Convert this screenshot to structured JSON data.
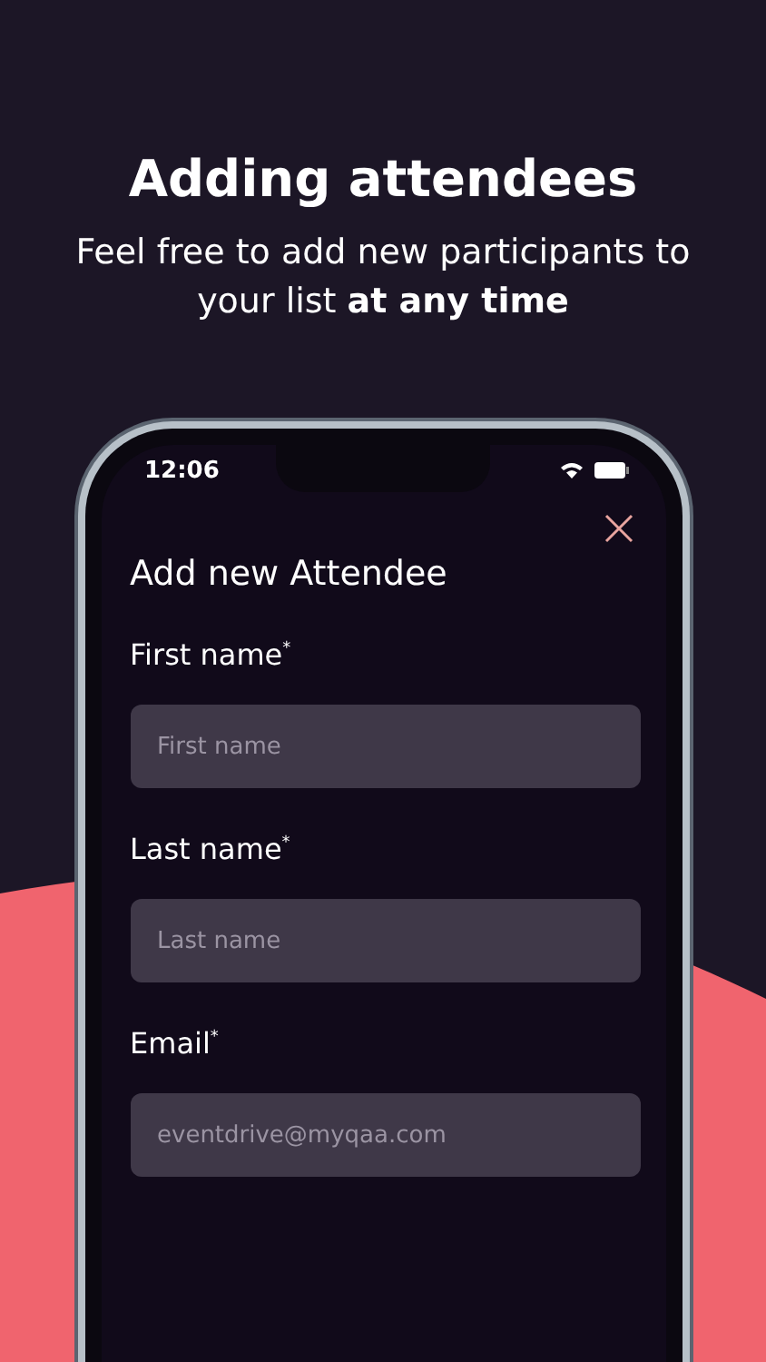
{
  "headline": "Adding attendees",
  "subtitle": "Feel free to add new participants to your list **at any time**",
  "status_bar": {
    "time": "12:06"
  },
  "form": {
    "title": "Add new Attendee",
    "fields": [
      {
        "label": "First name$^{*}$",
        "placeholder": "First name"
      },
      {
        "label": "Last name$^{*}$",
        "placeholder": "Last name"
      },
      {
        "label": "Email$^{*}$",
        "placeholder": "eventdrive@myqaa.com"
      }
    ]
  }
}
